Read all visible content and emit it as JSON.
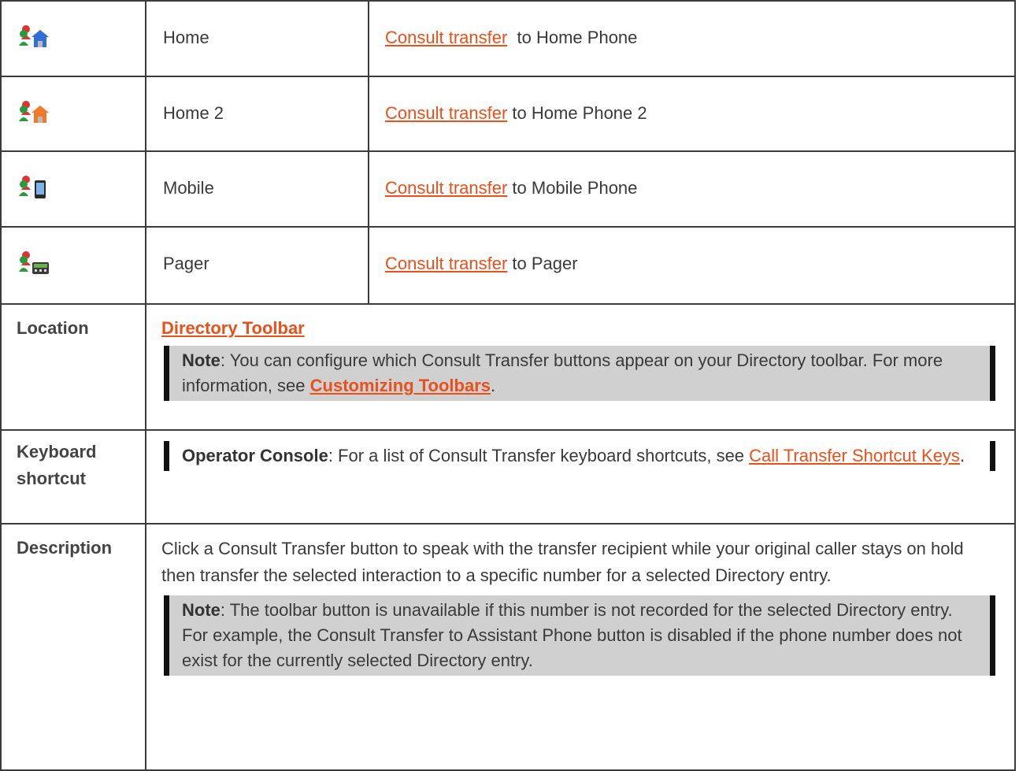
{
  "rows": [
    {
      "icon": "consult-transfer-home-icon",
      "name": "Home",
      "link": "Consult transfer",
      "action_suffix": "  to Home Phone"
    },
    {
      "icon": "consult-transfer-home2-icon",
      "name": "Home 2",
      "link": "Consult transfer",
      "action_suffix": " to Home Phone 2"
    },
    {
      "icon": "consult-transfer-mobile-icon",
      "name": "Mobile",
      "link": "Consult transfer",
      "action_suffix": " to Mobile Phone"
    },
    {
      "icon": "consult-transfer-pager-icon",
      "name": "Pager",
      "link": "Consult transfer",
      "action_suffix": " to Pager"
    }
  ],
  "location": {
    "label": "Location",
    "link": "Directory Toolbar",
    "note_label": "Note",
    "note_text": ": You can configure which Consult Transfer buttons appear on your Directory toolbar. For more information, see ",
    "note_link": "Customizing Toolbars",
    "note_end": "."
  },
  "keyboard": {
    "label_line1": "Keyboard",
    "label_line2": "shortcut",
    "note_label": "Operator Console",
    "note_text": ": For a list of Consult Transfer keyboard shortcuts, see ",
    "note_link": "Call Transfer Shortcut Keys",
    "note_end": "."
  },
  "description": {
    "label": "Description",
    "text": "Click a Consult Transfer button to speak with the transfer recipient while your original caller stays on hold then transfer the selected interaction to a specific number for a selected Directory entry.",
    "note_label": "Note",
    "note_text": ": The toolbar button is unavailable if this number is not recorded for the selected Directory entry. For example, the Consult Transfer to Assistant Phone button is disabled if the phone number does not exist for the currently selected Directory entry."
  },
  "colors": {
    "link": "#e8501c",
    "note_bg": "#d0d0d0",
    "border": "#3b3b3b",
    "home_roof": "#2f6fd6",
    "home2_roof": "#f07a2a"
  }
}
